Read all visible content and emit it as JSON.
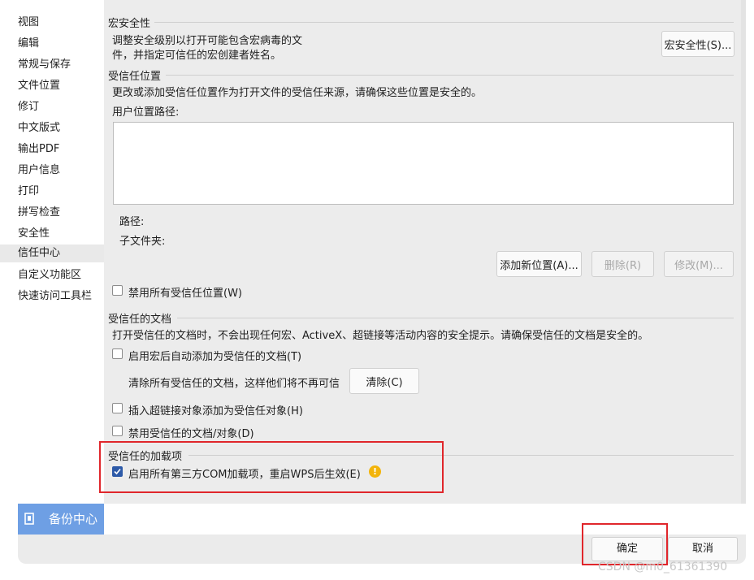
{
  "sidebar": {
    "items": [
      {
        "label": "视图"
      },
      {
        "label": "编辑"
      },
      {
        "label": "常规与保存"
      },
      {
        "label": "文件位置"
      },
      {
        "label": "修订"
      },
      {
        "label": "中文版式"
      },
      {
        "label": "输出PDF"
      },
      {
        "label": "用户信息"
      },
      {
        "label": "打印"
      },
      {
        "label": "拼写检查"
      },
      {
        "label": "安全性"
      },
      {
        "label": "信任中心"
      },
      {
        "label": "自定义功能区"
      },
      {
        "label": "快速访问工具栏"
      }
    ],
    "active_item": "信任中心",
    "backup": {
      "label": "备份中心",
      "icon": "backup-icon"
    }
  },
  "macro_security": {
    "title": "宏安全性",
    "description_line1": "调整安全级别以打开可能包含宏病毒的文",
    "description_line2": "件，并指定可信任的宏创建者姓名。",
    "button_label": "宏安全性(S)..."
  },
  "trusted_locations": {
    "title": "受信任位置",
    "description": "更改或添加受信任位置作为打开文件的受信任来源，请确保这些位置是安全的。",
    "list_label": "用户位置路径:",
    "path_label": "路径:",
    "subfolder_label": "子文件夹:",
    "add_button": "添加新位置(A)...",
    "delete_button": "删除(R)",
    "modify_button": "修改(M)...",
    "disable_all_label": "禁用所有受信任位置(W)",
    "disable_all_checked": false
  },
  "trusted_documents": {
    "title": "受信任的文档",
    "description": "打开受信任的文档时，不会出现任何宏、ActiveX、超链接等活动内容的安全提示。请确保受信任的文档是安全的。",
    "auto_add_label": "启用宏后自动添加为受信任的文档(T)",
    "auto_add_checked": false,
    "clear_text": "清除所有受信任的文档，这样他们将不再可信",
    "clear_button": "清除(C)",
    "hyperlink_label": "插入超链接对象添加为受信任对象(H)",
    "hyperlink_checked": false,
    "disable_label": "禁用受信任的文档/对象(D)",
    "disable_checked": false
  },
  "trusted_addins": {
    "title": "受信任的加载项",
    "enable_com_label": "启用所有第三方COM加载项，重启WPS后生效(E)",
    "enable_com_checked": true,
    "warning_icon": "warning-icon",
    "warning_symbol": "!"
  },
  "dialog": {
    "ok_button": "确定",
    "cancel_button": "取消"
  },
  "watermark": "CSDN @m0_61361390",
  "colors": {
    "highlight_border": "#e0262b",
    "accent_blue": "#2d5aa8",
    "backup_bg": "#6e9fe4",
    "warning": "#f3b40a"
  }
}
